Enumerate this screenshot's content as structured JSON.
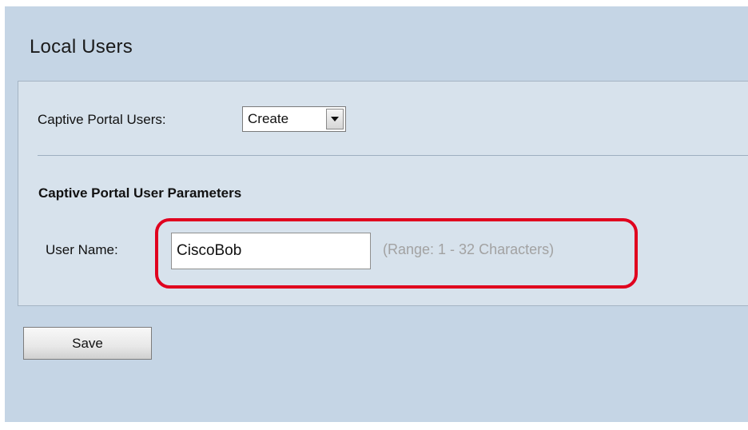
{
  "page": {
    "title": "Local Users"
  },
  "captive_portal": {
    "label": "Captive Portal Users:",
    "selected": "Create"
  },
  "parameters": {
    "heading": "Captive Portal User Parameters",
    "user_name_label": "User Name:",
    "user_name_value": "CiscoBob",
    "range_hint": "(Range: 1 - 32 Characters)"
  },
  "actions": {
    "save_label": "Save"
  },
  "colors": {
    "background": "#c5d5e5",
    "panel": "#d7e2ec",
    "highlight": "#e0001e",
    "hint_text": "#a2a2a2"
  },
  "icons": {
    "dropdown": "chevron-down-icon"
  }
}
